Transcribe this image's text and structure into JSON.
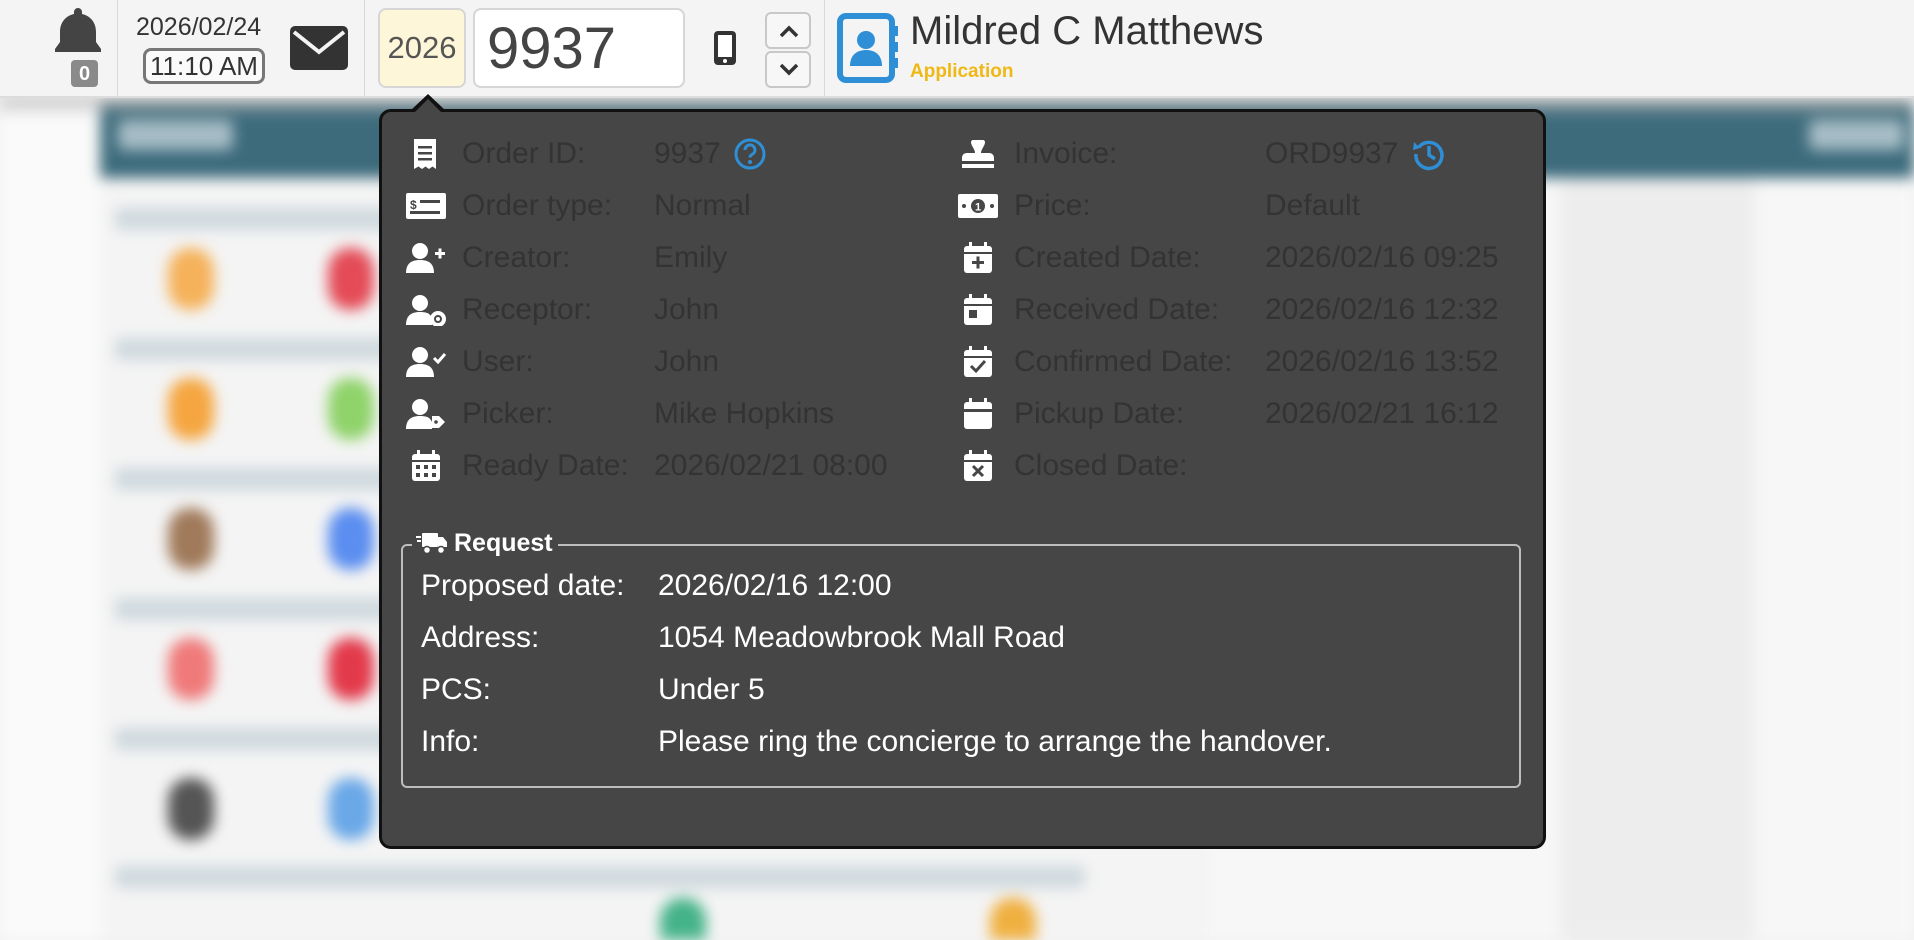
{
  "header": {
    "notifications_count": "0",
    "date": "2026/02/24",
    "time": "11:10 AM",
    "year": "2026",
    "order_number": "9937",
    "contact_name": "Mildred C Matthews",
    "contact_source": "Application"
  },
  "order": {
    "left": [
      {
        "icon": "receipt-icon",
        "label": "Order ID:",
        "value": "9937"
      },
      {
        "icon": "money-bill-icon",
        "label": "Order type:",
        "value": "Normal"
      },
      {
        "icon": "user-plus-icon",
        "label": "Creator:",
        "value": "Emily"
      },
      {
        "icon": "user-gear-icon",
        "label": "Receptor:",
        "value": "John"
      },
      {
        "icon": "user-check-icon",
        "label": "User:",
        "value": "John"
      },
      {
        "icon": "user-tag-icon",
        "label": "Picker:",
        "value": "Mike Hopkins"
      },
      {
        "icon": "calendar-days-icon",
        "label": "Ready Date:",
        "value": "2026/02/21 08:00"
      }
    ],
    "right": [
      {
        "icon": "stamp-icon",
        "label": "Invoice:",
        "value": "ORD9937"
      },
      {
        "icon": "banknote-icon",
        "label": "Price:",
        "value": "Default"
      },
      {
        "icon": "calendar-plus-icon",
        "label": "Created Date:",
        "value": "2026/02/16 09:25"
      },
      {
        "icon": "calendar-day-icon",
        "label": "Received Date:",
        "value": "2026/02/16 12:32"
      },
      {
        "icon": "calendar-check-icon",
        "label": "Confirmed Date:",
        "value": "2026/02/16 13:52"
      },
      {
        "icon": "calendar-icon",
        "label": "Pickup Date:",
        "value": "2026/02/21 16:12"
      },
      {
        "icon": "calendar-xmark-icon",
        "label": "Closed Date:",
        "value": ""
      }
    ]
  },
  "request": {
    "title": "Request",
    "rows": [
      {
        "label": "Proposed date:",
        "value": "2026/02/16 12:00"
      },
      {
        "label": "Address:",
        "value": "1054 Meadowbrook Mall Road"
      },
      {
        "label": "PCS:",
        "value": "Under 5"
      },
      {
        "label": "Info:",
        "value": "Please ring the concierge to arrange the handover."
      }
    ]
  },
  "colors": {
    "popover_bg": "#464646",
    "accent_blue": "#2f8fd6",
    "accent_yellow": "#efb814"
  }
}
